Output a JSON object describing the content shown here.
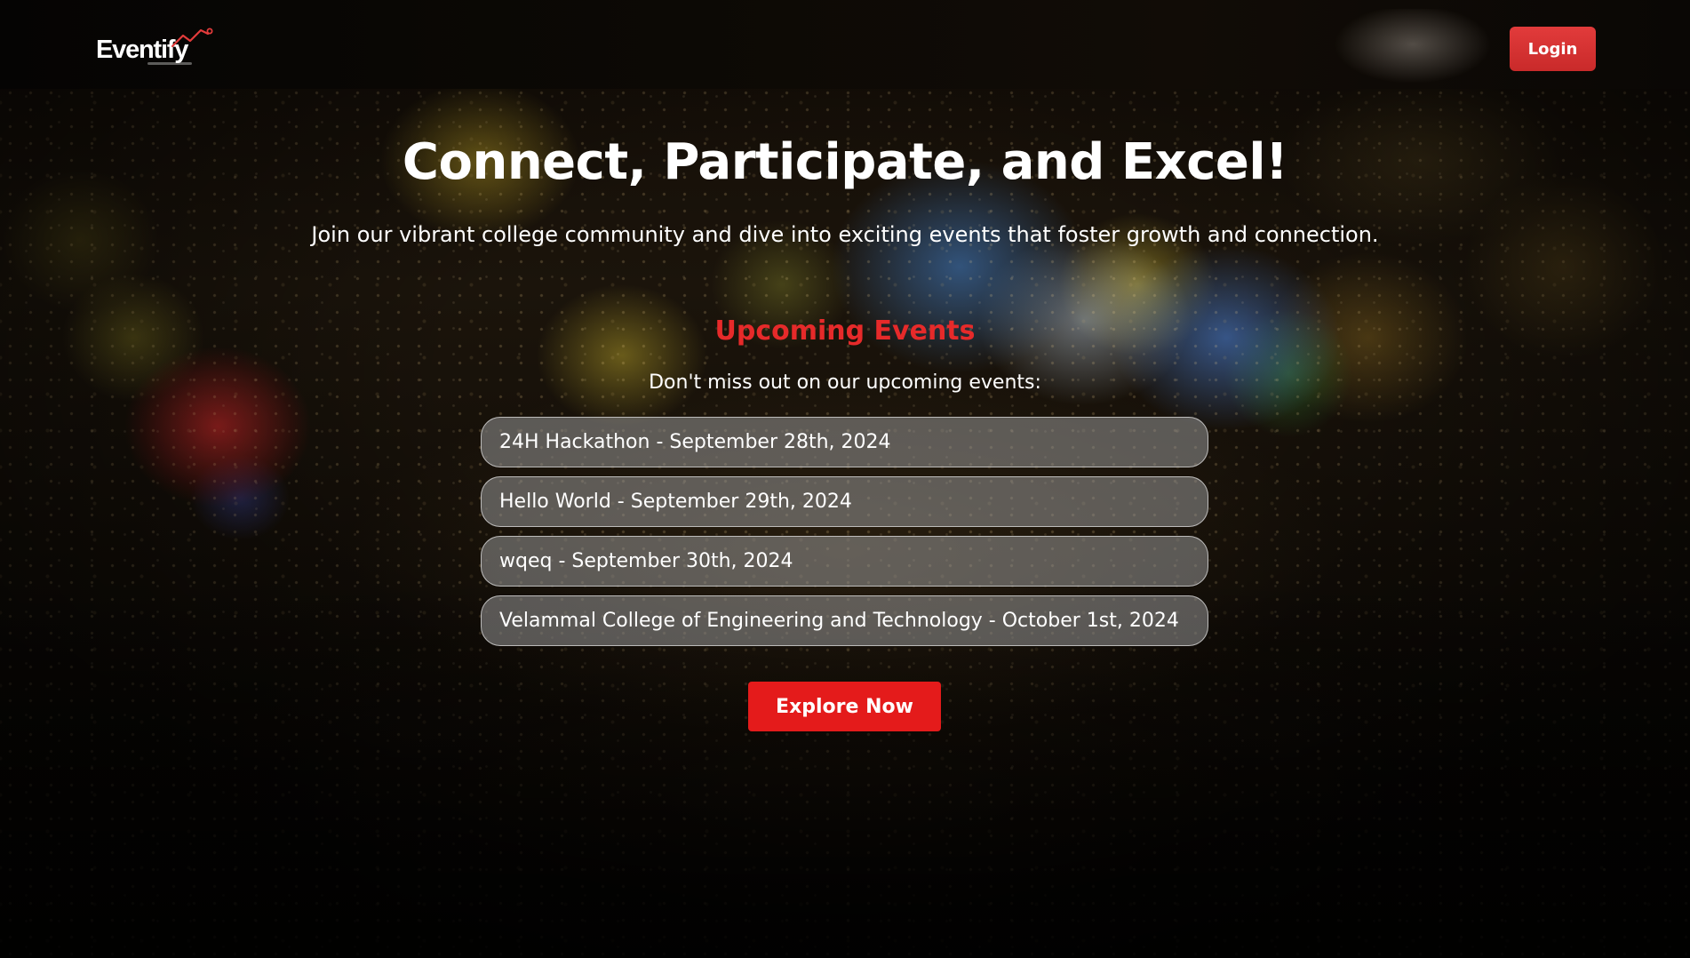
{
  "header": {
    "logo_text": "Eventify",
    "login_label": "Login"
  },
  "hero": {
    "title": "Connect, Participate, and Excel!",
    "subtitle": "Join our vibrant college community and dive into exciting events that foster growth and connection."
  },
  "events": {
    "title": "Upcoming Events",
    "subtitle": "Don't miss out on our upcoming events:",
    "items": [
      "24H Hackathon - September 28th, 2024",
      "Hello World - September 29th, 2024",
      "wqeq - September 30th, 2024",
      "Velammal College of Engineering and Technology - October 1st, 2024"
    ]
  },
  "cta": {
    "explore_label": "Explore Now"
  },
  "colors": {
    "accent": "#e41b1b",
    "events_title": "#e62a2a",
    "login_button": "#d83232"
  }
}
